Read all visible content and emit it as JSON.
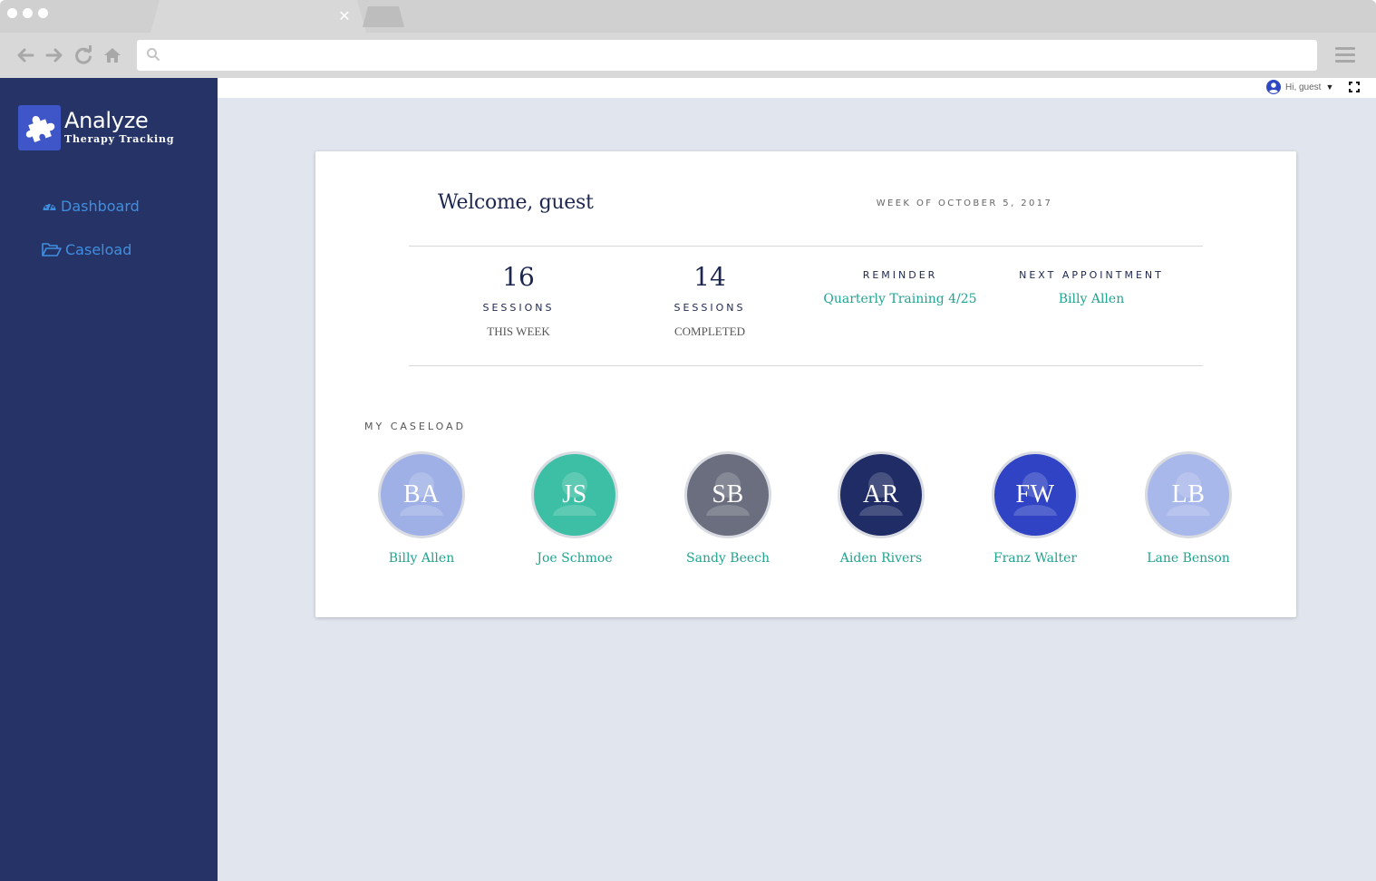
{
  "brand": {
    "title": "Analyze",
    "subtitle": "Therapy Tracking"
  },
  "sidebar": {
    "items": [
      {
        "label": "Dashboard",
        "icon": "dashboard-icon"
      },
      {
        "label": "Caseload",
        "icon": "folder-open-icon"
      }
    ]
  },
  "header": {
    "user_greeting": "Hi, guest"
  },
  "dashboard": {
    "welcome": "Welcome, guest",
    "week": "WEEK OF OCTOBER 5, 2017",
    "stats": [
      {
        "value": "16",
        "label": "SESSIONS",
        "sublabel": "THIS WEEK"
      },
      {
        "value": "14",
        "label": "SESSIONS",
        "sublabel": "COMPLETED"
      }
    ],
    "reminder": {
      "label": "REMINDER",
      "value": "Quarterly Training 4/25"
    },
    "next_appointment": {
      "label": "NEXT APPOINTMENT",
      "value": "Billy Allen"
    }
  },
  "caseload": {
    "title": "MY CASELOAD",
    "people": [
      {
        "initials": "BA",
        "name": "Billy Allen",
        "color": "#9fb0e6"
      },
      {
        "initials": "JS",
        "name": "Joe Schmoe",
        "color": "#3cbfa4"
      },
      {
        "initials": "SB",
        "name": "Sandy Beech",
        "color": "#6b6e7e"
      },
      {
        "initials": "AR",
        "name": "Aiden Rivers",
        "color": "#1f2c66"
      },
      {
        "initials": "FW",
        "name": "Franz Walter",
        "color": "#2f43c4"
      },
      {
        "initials": "LB",
        "name": "Lane Benson",
        "color": "#a9b8ea"
      }
    ]
  },
  "colors": {
    "sidebar_bg": "#253366",
    "accent_teal": "#22a38f",
    "nav_link": "#3f8fe0",
    "main_bg": "#e1e5ed"
  }
}
